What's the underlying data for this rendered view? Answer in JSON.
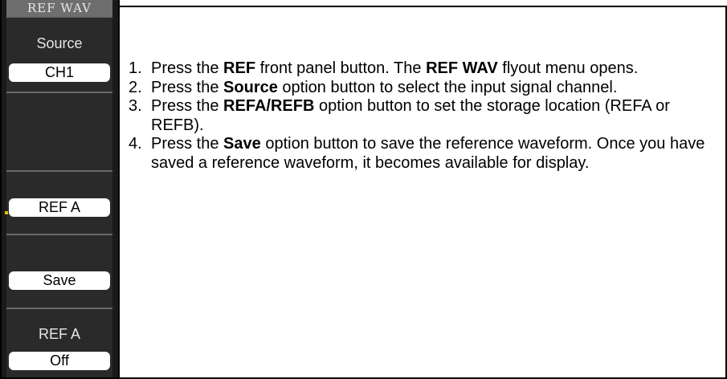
{
  "menu": {
    "title": "REF WAV",
    "source_label": "Source",
    "source_value": "CH1",
    "refab_value": "REF A",
    "save_value": "Save",
    "ref_label": "REF A",
    "ref_value": "Off",
    "marker_color": "#e0c000"
  },
  "steps": [
    {
      "n": "1.",
      "p1": "Press the ",
      "b1": "REF",
      "p2": " front panel button. The ",
      "b2": "REF WAV",
      "p3": " flyout menu opens."
    },
    {
      "n": "2.",
      "p1": "Press the ",
      "b1": "Source",
      "p2": " option button to select the input signal channel."
    },
    {
      "n": "3.",
      "p1": "Press the ",
      "b1": "REFA/REFB",
      "p2": " option button to set the storage location (REFA or REFB)."
    },
    {
      "n": "4.",
      "p1": "Press the ",
      "b1": "Save",
      "p2": " option button to save the reference waveform. Once you have saved a reference waveform, it becomes available for display."
    }
  ]
}
